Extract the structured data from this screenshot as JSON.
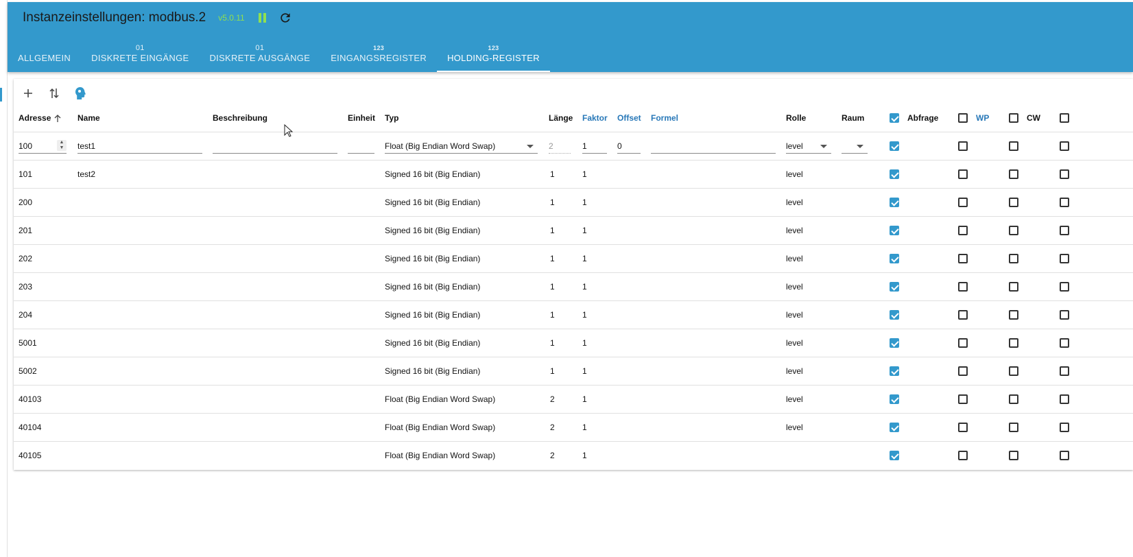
{
  "app": {
    "title": "Instanzeinstellungen: modbus.2",
    "version": "v5.0.11"
  },
  "colors": {
    "primary": "#3399cc",
    "accent_green": "#90e050",
    "header_link": "#2878b8"
  },
  "tabs": [
    {
      "icon": "",
      "label": "ALLGEMEIN",
      "active": false
    },
    {
      "icon": "01",
      "label": "DISKRETE EINGÄNGE",
      "active": false
    },
    {
      "icon": "01",
      "label": "DISKRETE AUSGÄNGE",
      "active": false
    },
    {
      "icon": "123",
      "label": "EINGANGSREGISTER",
      "active": false
    },
    {
      "icon": "123",
      "label": "HOLDING-REGISTER",
      "active": true
    }
  ],
  "toolbar": {
    "icons": [
      "add-icon",
      "import-export-icon",
      "ai-head-icon"
    ]
  },
  "columns": {
    "address": "Adresse",
    "name": "Name",
    "description": "Beschreibung",
    "unit": "Einheit",
    "type": "Typ",
    "length": "Länge",
    "factor": "Faktor",
    "offset": "Offset",
    "formula": "Formel",
    "role": "Rolle",
    "room": "Raum",
    "poll": "Abfrage",
    "wp": "WP",
    "cw": "CW"
  },
  "header_checks": {
    "poll": true,
    "wp": false,
    "cw": false,
    "extra": false
  },
  "edit_row": {
    "address": "100",
    "name": "test1",
    "description": "",
    "unit": "",
    "type": "Float (Big Endian Word Swap)",
    "length": "2",
    "factor": "1",
    "offset": "0",
    "formula": "",
    "role": "level",
    "room": "",
    "poll": true,
    "wp": false,
    "cw": false,
    "extra": false
  },
  "rows": [
    {
      "address": "101",
      "name": "test2",
      "type": "Signed 16 bit (Big Endian)",
      "length": "1",
      "factor": "1",
      "role": "level"
    },
    {
      "address": "200",
      "name": "",
      "type": "Signed 16 bit (Big Endian)",
      "length": "1",
      "factor": "1",
      "role": "level"
    },
    {
      "address": "201",
      "name": "",
      "type": "Signed 16 bit (Big Endian)",
      "length": "1",
      "factor": "1",
      "role": "level"
    },
    {
      "address": "202",
      "name": "",
      "type": "Signed 16 bit (Big Endian)",
      "length": "1",
      "factor": "1",
      "role": "level"
    },
    {
      "address": "203",
      "name": "",
      "type": "Signed 16 bit (Big Endian)",
      "length": "1",
      "factor": "1",
      "role": "level"
    },
    {
      "address": "204",
      "name": "",
      "type": "Signed 16 bit (Big Endian)",
      "length": "1",
      "factor": "1",
      "role": "level"
    },
    {
      "address": "5001",
      "name": "",
      "type": "Signed 16 bit (Big Endian)",
      "length": "1",
      "factor": "1",
      "role": "level"
    },
    {
      "address": "5002",
      "name": "",
      "type": "Signed 16 bit (Big Endian)",
      "length": "1",
      "factor": "1",
      "role": "level"
    },
    {
      "address": "40103",
      "name": "",
      "type": "Float (Big Endian Word Swap)",
      "length": "2",
      "factor": "1",
      "role": "level"
    },
    {
      "address": "40104",
      "name": "",
      "type": "Float (Big Endian Word Swap)",
      "length": "2",
      "factor": "1",
      "role": "level"
    },
    {
      "address": "40105",
      "name": "",
      "type": "Float (Big Endian Word Swap)",
      "length": "2",
      "factor": "1",
      "role": ""
    }
  ]
}
